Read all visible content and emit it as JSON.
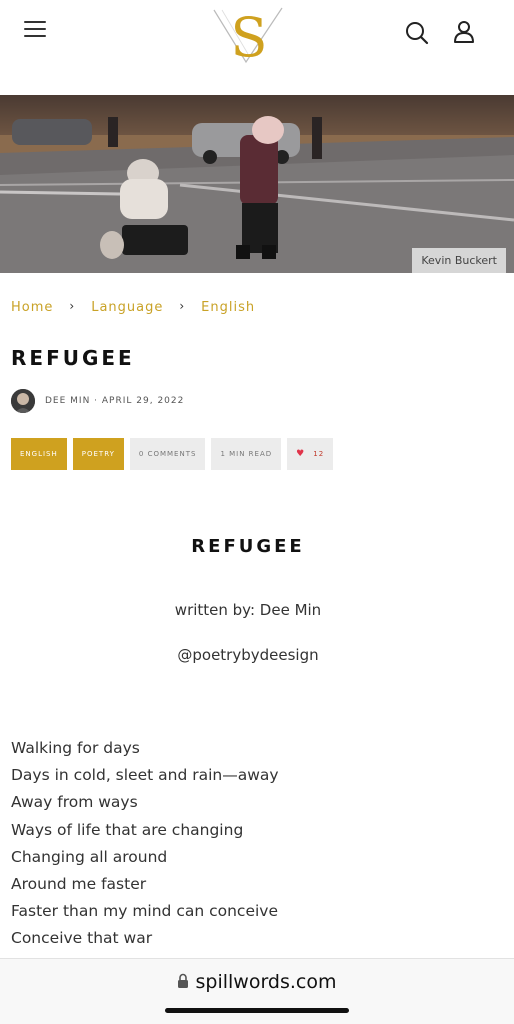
{
  "header": {
    "logo_letter": "S",
    "icons": {
      "menu": "hamburger-menu-icon",
      "search": "search-icon",
      "user": "user-icon"
    }
  },
  "hero": {
    "photo_credit": "Kevin Buckert"
  },
  "breadcrumb": {
    "items": [
      "Home",
      "Language",
      "English"
    ],
    "separator": "›"
  },
  "post": {
    "title": "REFUGEE",
    "author": "DEE MIN",
    "meta": "DEE MIN · APRIL 29, 2022",
    "tags": [
      "ENGLISH",
      "POETRY"
    ],
    "comments": "0 COMMENTS",
    "read_time": "1 MIN READ",
    "likes": "12"
  },
  "poem": {
    "title": "REFUGEE",
    "byline": "written by: Dee Min",
    "handle": "@poetrybydeesign",
    "lines": [
      "Walking for days",
      "Days in cold, sleet and rain—away",
      "Away from ways",
      "Ways of life that are changing",
      "Changing all around",
      "Around me faster",
      "Faster than my mind can conceive",
      "Conceive that war"
    ]
  },
  "browser": {
    "url": "spillwords.com"
  },
  "colors": {
    "accent": "#cfa11f",
    "heart": "#e0344a"
  }
}
